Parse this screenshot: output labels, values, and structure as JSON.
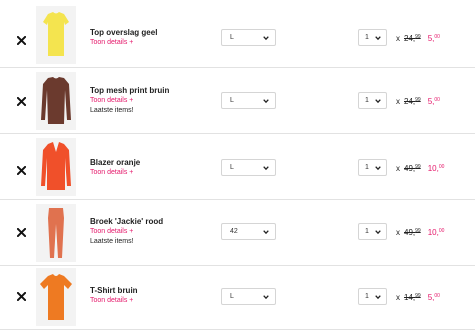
{
  "colors": {
    "accent": "#e5196b",
    "separator": "#e2e2e2"
  },
  "items": [
    {
      "name": "Top overslag geel",
      "details_link": "Toon details +",
      "stock_note": "",
      "size": "L",
      "quantity": "1",
      "multiplier": "x",
      "old_price_main": "24,",
      "old_price_dec": "99",
      "new_price_main": "5,",
      "new_price_dec": "00",
      "garment_color": "#f4e44f",
      "garment_type": "top"
    },
    {
      "name": "Top mesh print bruin",
      "details_link": "Toon details +",
      "stock_note": "Laatste items!",
      "size": "L",
      "quantity": "1",
      "multiplier": "x",
      "old_price_main": "24,",
      "old_price_dec": "99",
      "new_price_main": "5,",
      "new_price_dec": "00",
      "garment_color": "#6b3a2e",
      "garment_type": "longsleeve"
    },
    {
      "name": "Blazer oranje",
      "details_link": "Toon details +",
      "stock_note": "",
      "size": "L",
      "quantity": "1",
      "multiplier": "x",
      "old_price_main": "49,",
      "old_price_dec": "99",
      "new_price_main": "10,",
      "new_price_dec": "00",
      "garment_color": "#f0502a",
      "garment_type": "blazer"
    },
    {
      "name": "Broek 'Jackie' rood",
      "details_link": "Toon details +",
      "stock_note": "Laatste items!",
      "size": "42",
      "quantity": "1",
      "multiplier": "x",
      "old_price_main": "49,",
      "old_price_dec": "99",
      "new_price_main": "10,",
      "new_price_dec": "00",
      "garment_color": "#e0724f",
      "garment_type": "pants"
    },
    {
      "name": "T-Shirt bruin",
      "details_link": "Toon details +",
      "stock_note": "",
      "size": "L",
      "quantity": "1",
      "multiplier": "x",
      "old_price_main": "14,",
      "old_price_dec": "99",
      "new_price_main": "5,",
      "new_price_dec": "00",
      "garment_color": "#ee7a22",
      "garment_type": "tshirt"
    }
  ]
}
